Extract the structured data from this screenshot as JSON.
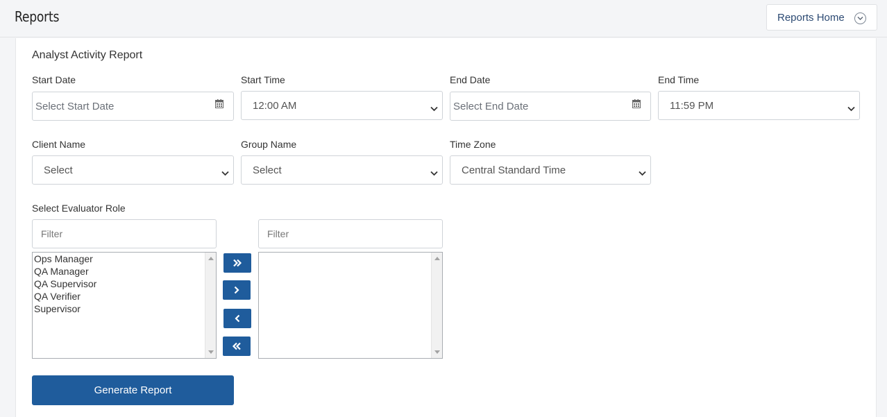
{
  "header": {
    "title": "Reports",
    "home_button": "Reports Home"
  },
  "report": {
    "title": "Analyst Activity Report",
    "start_date": {
      "label": "Start Date",
      "placeholder": "Select Start Date"
    },
    "start_time": {
      "label": "Start Time",
      "value": "12:00 AM"
    },
    "end_date": {
      "label": "End Date",
      "placeholder": "Select End Date"
    },
    "end_time": {
      "label": "End Time",
      "value": "11:59 PM"
    },
    "client_name": {
      "label": "Client Name",
      "value": "Select"
    },
    "group_name": {
      "label": "Group Name",
      "value": "Select"
    },
    "time_zone": {
      "label": "Time Zone",
      "value": "Central Standard Time"
    },
    "evaluator_role": {
      "label": "Select Evaluator Role",
      "left_filter_placeholder": "Filter",
      "right_filter_placeholder": "Filter",
      "available": [
        "Ops Manager",
        "QA Manager",
        "QA Supervisor",
        "QA Verifier",
        "Supervisor"
      ],
      "selected": []
    },
    "generate_button": "Generate Report"
  },
  "icons": {
    "calendar": "calendar-icon",
    "caret": "chevron-down-icon"
  },
  "colors": {
    "primary": "#1f5c9c",
    "link": "#2c4a73"
  }
}
